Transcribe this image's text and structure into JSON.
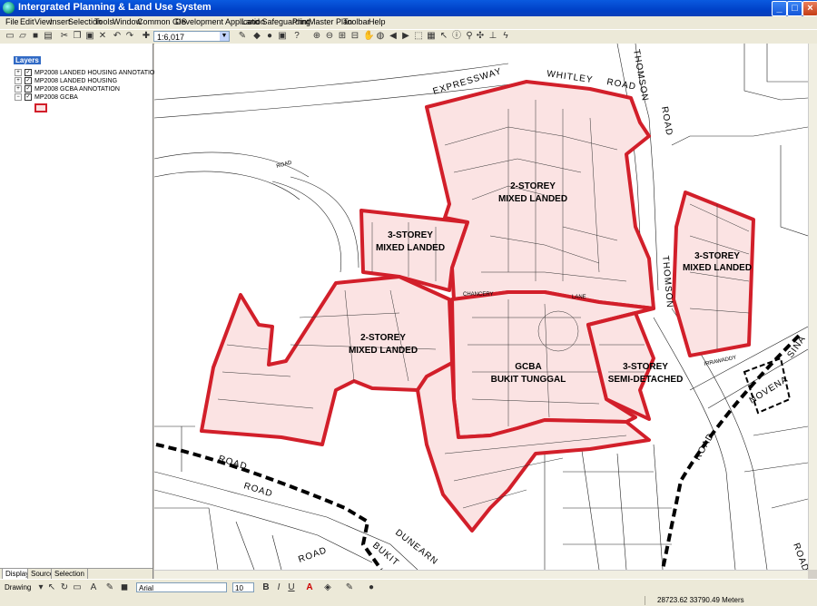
{
  "window": {
    "title": "Intergrated Planning & Land Use System"
  },
  "menu": [
    "File",
    "Edit",
    "View",
    "Insert",
    "Selection",
    "Tools",
    "Window",
    "Common GIS",
    "Development Application",
    "Land Safeguarding",
    "Print",
    "Master Plan",
    "Toolbar",
    "Help"
  ],
  "toolbar": {
    "scale": "1:6,017"
  },
  "toc": {
    "root": "Layers",
    "layers": [
      "MP2008 LANDED HOUSING ANNOTATION",
      "MP2008 LANDED HOUSING",
      "MP2008 GCBA ANNOTATION",
      "MP2008 GCBA"
    ],
    "tabs": [
      "Display",
      "Source",
      "Selection"
    ]
  },
  "map": {
    "zones": [
      {
        "line1": "2-STOREY",
        "line2": "MIXED LANDED"
      },
      {
        "line1": "3-STOREY",
        "line2": "MIXED LANDED"
      },
      {
        "line1": "3-STOREY",
        "line2": "MIXED LANDED"
      },
      {
        "line1": "2-STOREY",
        "line2": "MIXED LANDED"
      },
      {
        "line1": "GCBA",
        "line2": "BUKIT TUNGGAL"
      },
      {
        "line1": "3-STOREY",
        "line2": "SEMI-DETACHED"
      }
    ],
    "roads": {
      "expressway": "EXPRESSWAY",
      "whitley": "WHITLEY",
      "road": "ROAD",
      "thomson": "THOMSON",
      "dunearn": "DUNEARN",
      "bukit": "BUKIT",
      "novena": "NOVENA",
      "irrawaddy": "IRRAWADDY",
      "chancery": "CHANCERY",
      "lane": "LANE",
      "sina": "SINA"
    }
  },
  "drawing": {
    "label": "Drawing",
    "font": "Arial",
    "size": "10",
    "bold": "B",
    "italic": "I",
    "underline": "U",
    "text_tool": "A"
  },
  "status": {
    "coordinates": "28723.62  33790.49 Meters"
  },
  "colors": {
    "zone_stroke": "#d21f2a",
    "zone_fill": "#fbe3e3",
    "titlebar": "#0a5adf"
  }
}
